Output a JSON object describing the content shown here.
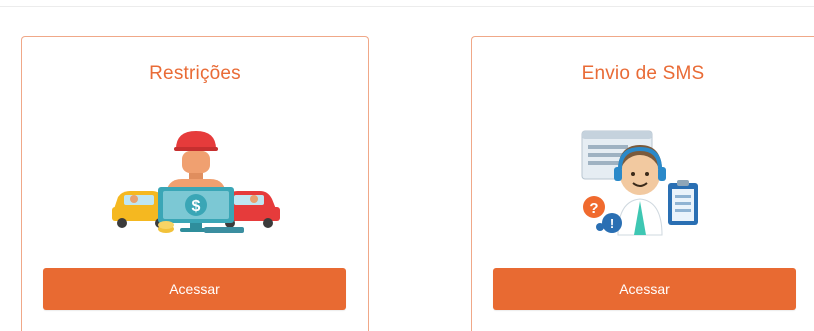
{
  "cards": [
    {
      "title": "Restrições",
      "button_label": "Acessar"
    },
    {
      "title": "Envio de SMS",
      "button_label": "Acessar"
    }
  ],
  "colors": {
    "accent": "#e86a32",
    "title": "#e96b36",
    "card_border": "#f0a888"
  },
  "icons": {
    "restrictions": "restrictions-illustration-icon",
    "sms": "sms-support-illustration-icon"
  }
}
